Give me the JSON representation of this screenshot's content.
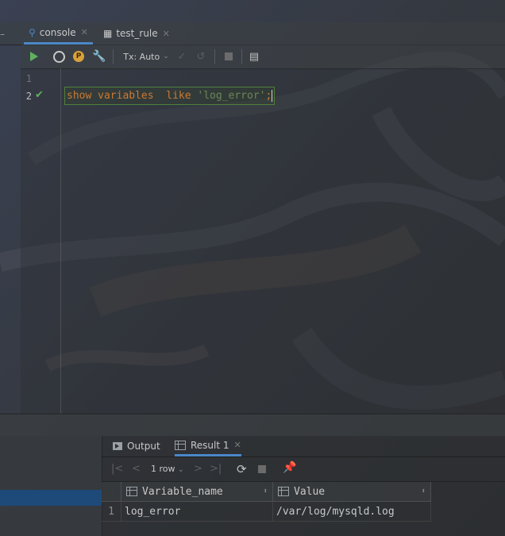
{
  "editor_tabs": [
    {
      "label": "console",
      "icon": "console-icon",
      "active": true
    },
    {
      "label": "test_rule",
      "icon": "table-icon",
      "active": false
    }
  ],
  "toolbar": {
    "tx_mode": "Tx: Auto"
  },
  "editor": {
    "line_numbers": [
      "1",
      "2"
    ],
    "code_tokens": {
      "kw1": "show",
      "kw2": "variables",
      "kw3": "like",
      "str": "'log_error'",
      "end": ";"
    }
  },
  "services": {
    "tabs": [
      {
        "label": "Output",
        "icon": "output-icon",
        "active": false
      },
      {
        "label": "Result 1",
        "icon": "table-icon",
        "active": true
      }
    ],
    "rows_label": "1 row"
  },
  "result_grid": {
    "columns": [
      "Variable_name",
      "Value"
    ],
    "rows": [
      {
        "num": "1",
        "cells": [
          "log_error",
          "/var/log/mysqld.log"
        ]
      }
    ]
  },
  "colors": {
    "accent": "#4a88c7",
    "keyword": "#cc7832",
    "string": "#6a8759",
    "run": "#5fb05f"
  }
}
